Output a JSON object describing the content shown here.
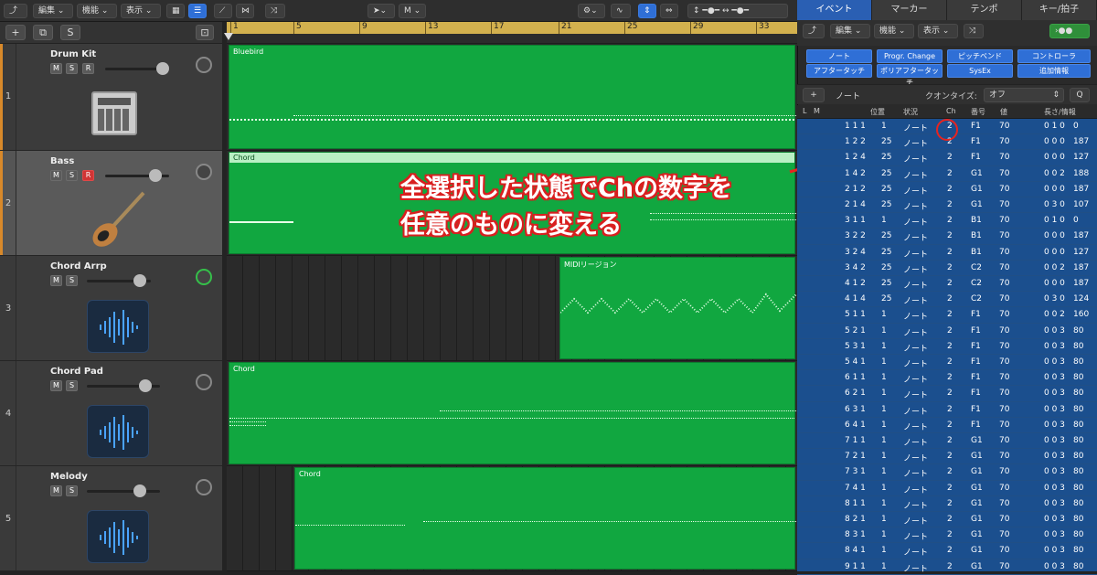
{
  "toolbar": {
    "edit": "編集",
    "function": "機能",
    "view": "表示",
    "tool_label": "M"
  },
  "ruler": [
    "1",
    "5",
    "9",
    "13",
    "17",
    "21",
    "25",
    "29",
    "33"
  ],
  "tracks": [
    {
      "num": "1",
      "name": "Drum Kit",
      "m": "M",
      "s": "S",
      "r": "R",
      "region": "Bluebird"
    },
    {
      "num": "2",
      "name": "Bass",
      "m": "M",
      "s": "S",
      "r": "R",
      "region": "Chord"
    },
    {
      "num": "3",
      "name": "Chord Arrp",
      "m": "M",
      "s": "S",
      "r": "",
      "region": "MIDIリージョン"
    },
    {
      "num": "4",
      "name": "Chord Pad",
      "m": "M",
      "s": "S",
      "r": "",
      "region": "Chord"
    },
    {
      "num": "5",
      "name": "Melody",
      "m": "M",
      "s": "S",
      "r": "",
      "region": "Chord"
    }
  ],
  "header_buttons": {
    "add": "+",
    "s": "S"
  },
  "callout": {
    "line1": "全選択した状態でChの数字を",
    "line2": "任意のものに変える"
  },
  "panel": {
    "tabs": [
      "イベント",
      "マーカー",
      "テンポ",
      "キー/拍子"
    ],
    "edit": "編集",
    "function": "機能",
    "view": "表示",
    "filters": [
      "ノート",
      "Progr. Change",
      "ピッチベンド",
      "コントローラ",
      "アフタータッチ",
      "ポリアフタータッチ",
      "SysEx",
      "追加情報"
    ],
    "add": "+",
    "note_label": "ノート",
    "quantize_label": "クオンタイズ:",
    "quantize_value": "オフ",
    "q_button": "Q",
    "columns": {
      "l": "L",
      "m": "M",
      "position": "位置",
      "status": "状況",
      "ch": "Ch",
      "num": "番号",
      "value": "値",
      "length": "長さ/情報"
    }
  },
  "events": [
    {
      "pos": "1 1 1",
      "tick": "1",
      "status": "ノート",
      "ch": "2",
      "num": "F1",
      "val": "70",
      "len": "0 1 0",
      "len2": "0"
    },
    {
      "pos": "1 2 2",
      "tick": "25",
      "status": "ノート",
      "ch": "2",
      "num": "F1",
      "val": "70",
      "len": "0 0 0",
      "len2": "187"
    },
    {
      "pos": "1 2 4",
      "tick": "25",
      "status": "ノート",
      "ch": "2",
      "num": "F1",
      "val": "70",
      "len": "0 0 0",
      "len2": "127"
    },
    {
      "pos": "1 4 2",
      "tick": "25",
      "status": "ノート",
      "ch": "2",
      "num": "G1",
      "val": "70",
      "len": "0 0 2",
      "len2": "188"
    },
    {
      "pos": "2 1 2",
      "tick": "25",
      "status": "ノート",
      "ch": "2",
      "num": "G1",
      "val": "70",
      "len": "0 0 0",
      "len2": "187"
    },
    {
      "pos": "2 1 4",
      "tick": "25",
      "status": "ノート",
      "ch": "2",
      "num": "G1",
      "val": "70",
      "len": "0 3 0",
      "len2": "107"
    },
    {
      "pos": "3 1 1",
      "tick": "1",
      "status": "ノート",
      "ch": "2",
      "num": "B1",
      "val": "70",
      "len": "0 1 0",
      "len2": "0"
    },
    {
      "pos": "3 2 2",
      "tick": "25",
      "status": "ノート",
      "ch": "2",
      "num": "B1",
      "val": "70",
      "len": "0 0 0",
      "len2": "187"
    },
    {
      "pos": "3 2 4",
      "tick": "25",
      "status": "ノート",
      "ch": "2",
      "num": "B1",
      "val": "70",
      "len": "0 0 0",
      "len2": "127"
    },
    {
      "pos": "3 4 2",
      "tick": "25",
      "status": "ノート",
      "ch": "2",
      "num": "C2",
      "val": "70",
      "len": "0 0 2",
      "len2": "187"
    },
    {
      "pos": "4 1 2",
      "tick": "25",
      "status": "ノート",
      "ch": "2",
      "num": "C2",
      "val": "70",
      "len": "0 0 0",
      "len2": "187"
    },
    {
      "pos": "4 1 4",
      "tick": "25",
      "status": "ノート",
      "ch": "2",
      "num": "C2",
      "val": "70",
      "len": "0 3 0",
      "len2": "124"
    },
    {
      "pos": "5 1 1",
      "tick": "1",
      "status": "ノート",
      "ch": "2",
      "num": "F1",
      "val": "70",
      "len": "0 0 2",
      "len2": "160"
    },
    {
      "pos": "5 2 1",
      "tick": "1",
      "status": "ノート",
      "ch": "2",
      "num": "F1",
      "val": "70",
      "len": "0 0 3",
      "len2": "80"
    },
    {
      "pos": "5 3 1",
      "tick": "1",
      "status": "ノート",
      "ch": "2",
      "num": "F1",
      "val": "70",
      "len": "0 0 3",
      "len2": "80"
    },
    {
      "pos": "5 4 1",
      "tick": "1",
      "status": "ノート",
      "ch": "2",
      "num": "F1",
      "val": "70",
      "len": "0 0 3",
      "len2": "80"
    },
    {
      "pos": "6 1 1",
      "tick": "1",
      "status": "ノート",
      "ch": "2",
      "num": "F1",
      "val": "70",
      "len": "0 0 3",
      "len2": "80"
    },
    {
      "pos": "6 2 1",
      "tick": "1",
      "status": "ノート",
      "ch": "2",
      "num": "F1",
      "val": "70",
      "len": "0 0 3",
      "len2": "80"
    },
    {
      "pos": "6 3 1",
      "tick": "1",
      "status": "ノート",
      "ch": "2",
      "num": "F1",
      "val": "70",
      "len": "0 0 3",
      "len2": "80"
    },
    {
      "pos": "6 4 1",
      "tick": "1",
      "status": "ノート",
      "ch": "2",
      "num": "F1",
      "val": "70",
      "len": "0 0 3",
      "len2": "80"
    },
    {
      "pos": "7 1 1",
      "tick": "1",
      "status": "ノート",
      "ch": "2",
      "num": "G1",
      "val": "70",
      "len": "0 0 3",
      "len2": "80"
    },
    {
      "pos": "7 2 1",
      "tick": "1",
      "status": "ノート",
      "ch": "2",
      "num": "G1",
      "val": "70",
      "len": "0 0 3",
      "len2": "80"
    },
    {
      "pos": "7 3 1",
      "tick": "1",
      "status": "ノート",
      "ch": "2",
      "num": "G1",
      "val": "70",
      "len": "0 0 3",
      "len2": "80"
    },
    {
      "pos": "7 4 1",
      "tick": "1",
      "status": "ノート",
      "ch": "2",
      "num": "G1",
      "val": "70",
      "len": "0 0 3",
      "len2": "80"
    },
    {
      "pos": "8 1 1",
      "tick": "1",
      "status": "ノート",
      "ch": "2",
      "num": "G1",
      "val": "70",
      "len": "0 0 3",
      "len2": "80"
    },
    {
      "pos": "8 2 1",
      "tick": "1",
      "status": "ノート",
      "ch": "2",
      "num": "G1",
      "val": "70",
      "len": "0 0 3",
      "len2": "80"
    },
    {
      "pos": "8 3 1",
      "tick": "1",
      "status": "ノート",
      "ch": "2",
      "num": "G1",
      "val": "70",
      "len": "0 0 3",
      "len2": "80"
    },
    {
      "pos": "8 4 1",
      "tick": "1",
      "status": "ノート",
      "ch": "2",
      "num": "G1",
      "val": "70",
      "len": "0 0 3",
      "len2": "80"
    },
    {
      "pos": "9 1 1",
      "tick": "1",
      "status": "ノート",
      "ch": "2",
      "num": "G1",
      "val": "70",
      "len": "0 0 3",
      "len2": "80"
    }
  ],
  "colors": {
    "region": "#11a740",
    "accent": "#2f6fd6",
    "annotation": "#e8241f",
    "ruler": "#d3b14e",
    "list_bg": "#1b4f8e"
  }
}
